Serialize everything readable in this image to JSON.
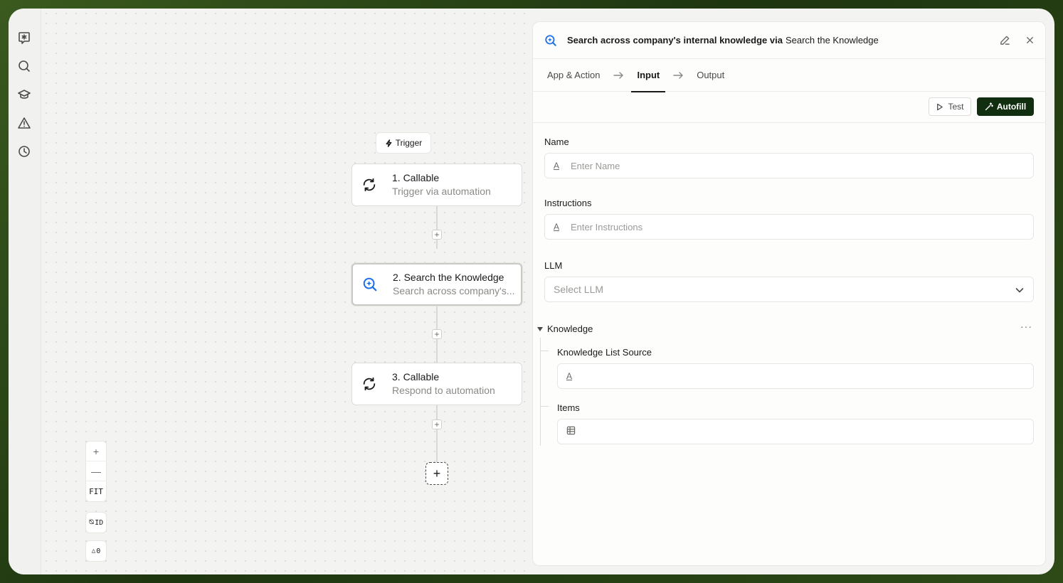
{
  "rail": {
    "icons": [
      "chat-star-icon",
      "search-icon",
      "graduation-cap-icon",
      "warning-icon",
      "history-icon"
    ]
  },
  "canvas": {
    "trigger_label": "Trigger",
    "nodes": [
      {
        "title": "1. Callable",
        "subtitle": "Trigger via automation",
        "icon": "sync-icon"
      },
      {
        "title": "2. Search the Knowledge",
        "subtitle": "Search across company's...",
        "icon": "knowledge-search-icon"
      },
      {
        "title": "3. Callable",
        "subtitle": "Respond to automation",
        "icon": "sync-icon"
      }
    ],
    "zoom": {
      "in": "+",
      "out": "—",
      "fit": "FIT"
    },
    "id_toggle": "ID",
    "warnings_count": "0"
  },
  "panel": {
    "header_bold": "Search across company's internal knowledge via",
    "header_app": "Search the Knowledge",
    "tabs": [
      "App & Action",
      "Input",
      "Output"
    ],
    "active_tab": "Input",
    "test_label": "Test",
    "autofill_label": "Autofill",
    "fields": {
      "name_label": "Name",
      "name_placeholder": "Enter Name",
      "instructions_label": "Instructions",
      "instructions_placeholder": "Enter Instructions",
      "llm_label": "LLM",
      "llm_placeholder": "Select LLM",
      "knowledge_section": "Knowledge",
      "knowledge_list_source_label": "Knowledge List Source",
      "items_label": "Items"
    }
  },
  "colors": {
    "accent_dark_green": "#122e10",
    "knowledge_icon_blue": "#1f6fe5",
    "canvas_bg": "#f3f3f1"
  }
}
